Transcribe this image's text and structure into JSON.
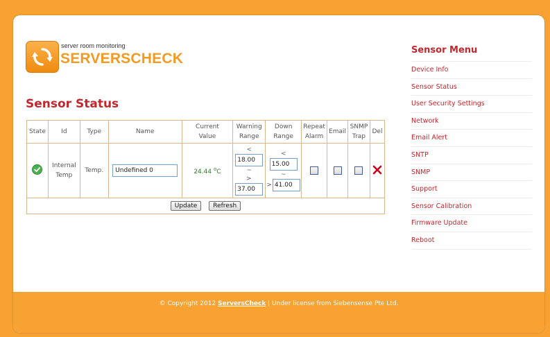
{
  "logo": {
    "tagline": "server room monitoring",
    "name": "SERVERSCHECK"
  },
  "page_title": "Sensor Status",
  "table": {
    "headers": {
      "state": "State",
      "id": "Id",
      "type": "Type",
      "name": "Name",
      "current_value": [
        "Current",
        "Value"
      ],
      "warning_range": [
        "Warning",
        "Range"
      ],
      "down_range": [
        "Down",
        "Range"
      ],
      "repeat_alarm": [
        "Repeat",
        "Alarm"
      ],
      "email": "Email",
      "snmp_trap": [
        "SNMP",
        "Trap"
      ],
      "del": "Del"
    },
    "row": {
      "state": "ok",
      "id": [
        "Internal",
        "Temp"
      ],
      "type": "Temp.",
      "name_value": "Undefined 0",
      "current_value": "24.44",
      "current_unit": "C",
      "current_unit_prefix": "o",
      "warning_lt": "<",
      "warning_low": "18.00",
      "warning_sep": "~",
      "warning_gt": ">",
      "warning_high": "37.00",
      "down_lt": "<",
      "down_low": "15.00",
      "down_sep": "~",
      "down_gt": ">",
      "down_high": "41.00",
      "repeat_alarm_checked": false,
      "email_checked": false,
      "snmp_trap_checked": false
    },
    "update_label": "Update",
    "refresh_label": "Refresh"
  },
  "sidebar": {
    "title": "Sensor Menu",
    "items": [
      {
        "label": "Device Info"
      },
      {
        "label": "Sensor Status"
      },
      {
        "label": "User Security Settings"
      },
      {
        "label": "Network"
      },
      {
        "label": "Email Alert"
      },
      {
        "label": "SNTP"
      },
      {
        "label": "SNMP"
      },
      {
        "label": "Support"
      },
      {
        "label": "Sensor Calibration"
      },
      {
        "label": "Firmware Update"
      },
      {
        "label": "Reboot"
      }
    ]
  },
  "footer": {
    "prefix": "© Copyright 2012 ",
    "link": "ServersCheck",
    "suffix": " | Under license from Siebensense Pte Ltd."
  },
  "colors": {
    "accent_orange": "#f7a233",
    "heading_red": "#c1272d",
    "value_green": "#2e7d1f",
    "state_ok_green": "#4caf50",
    "delete_red": "#d0021b"
  }
}
